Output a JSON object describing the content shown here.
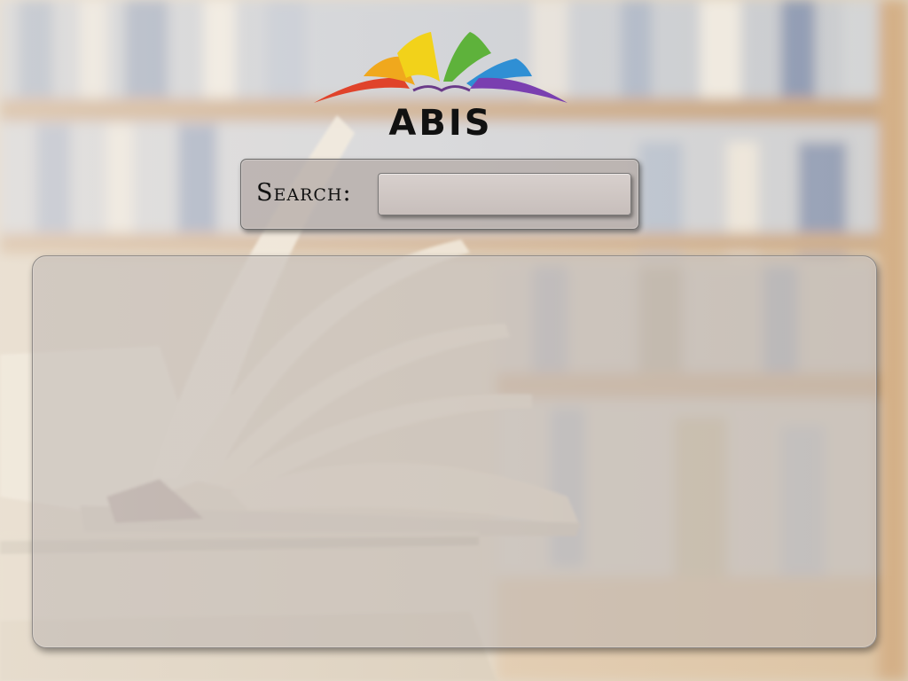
{
  "app": {
    "logo_text": "ABIS"
  },
  "logo": {
    "petal_colors": [
      "#e0432b",
      "#f0a81d",
      "#f2d21a",
      "#5eb23b",
      "#2f8fd4",
      "#7a3fb0"
    ]
  },
  "search": {
    "label": "Search:",
    "value": "",
    "placeholder": ""
  },
  "results": {
    "items": []
  }
}
